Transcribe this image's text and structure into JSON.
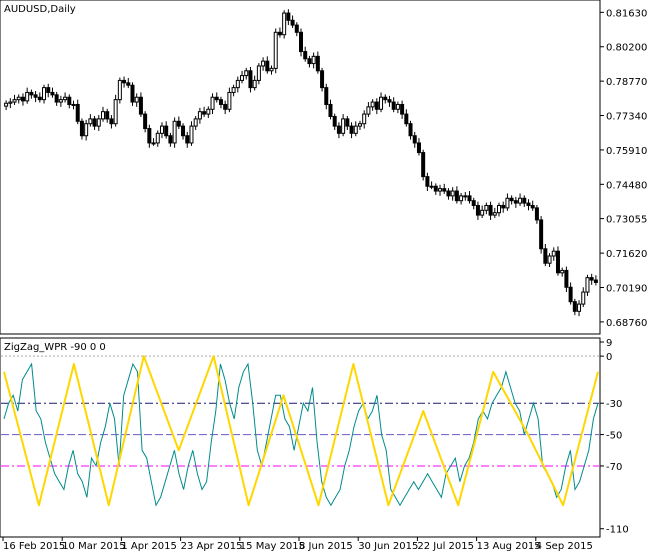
{
  "price_panel": {
    "title": "AUDUSD,Daily",
    "price_ticks": [
      "0.81630",
      "0.80200",
      "0.78770",
      "0.77340",
      "0.75910",
      "0.74480",
      "0.73055",
      "0.71620",
      "0.70190",
      "0.68760"
    ],
    "price_tick_values": [
      0.8163,
      0.802,
      0.7877,
      0.7734,
      0.7591,
      0.7448,
      0.73055,
      0.7162,
      0.7019,
      0.6876
    ]
  },
  "indicator_panel": {
    "title": "ZigZag_WPR -90 0 0",
    "ticks": [
      "9",
      "0",
      "-30",
      "-50",
      "-70",
      "-110"
    ],
    "tick_values": [
      9,
      0,
      -30,
      -50,
      -70,
      -110
    ]
  },
  "time_axis": {
    "labels": [
      "16 Feb 2015",
      "10 Mar 2015",
      "1 Apr 2015",
      "23 Apr 2015",
      "15 May 2015",
      "8 Jun 2015",
      "30 Jun 2015",
      "22 Jul 2015",
      "13 Aug 2015",
      "4 Sep 2015"
    ]
  },
  "colors": {
    "background": "#ffffff",
    "frame": "#000000",
    "candle": "#000000",
    "wpr_line": "#008b8b",
    "zigzag_line": "#ffd700",
    "level_minus30": "#191970",
    "level_minus50": "#6a5acd",
    "level_minus70": "#ff00ff",
    "level_0": "#a9a9a9"
  },
  "chart_data": [
    {
      "type": "candlestick",
      "title": "AUDUSD,Daily",
      "ylim": [
        0.6834,
        0.8206
      ],
      "closes": [
        0.7785,
        0.779,
        0.78,
        0.781,
        0.7795,
        0.783,
        0.782,
        0.781,
        0.78,
        0.785,
        0.783,
        0.782,
        0.779,
        0.78,
        0.781,
        0.778,
        0.778,
        0.771,
        0.765,
        0.77,
        0.772,
        0.769,
        0.772,
        0.775,
        0.772,
        0.77,
        0.78,
        0.788,
        0.787,
        0.786,
        0.779,
        0.781,
        0.774,
        0.768,
        0.762,
        0.762,
        0.766,
        0.769,
        0.765,
        0.762,
        0.771,
        0.769,
        0.765,
        0.762,
        0.769,
        0.772,
        0.775,
        0.774,
        0.776,
        0.781,
        0.78,
        0.778,
        0.776,
        0.783,
        0.785,
        0.788,
        0.79,
        0.792,
        0.785,
        0.788,
        0.794,
        0.796,
        0.792,
        0.793,
        0.808,
        0.807,
        0.816,
        0.813,
        0.811,
        0.808,
        0.8,
        0.797,
        0.795,
        0.798,
        0.792,
        0.785,
        0.778,
        0.773,
        0.769,
        0.766,
        0.772,
        0.769,
        0.766,
        0.769,
        0.77,
        0.774,
        0.777,
        0.779,
        0.776,
        0.781,
        0.78,
        0.779,
        0.776,
        0.778,
        0.774,
        0.77,
        0.765,
        0.762,
        0.758,
        0.748,
        0.744,
        0.744,
        0.742,
        0.743,
        0.742,
        0.74,
        0.742,
        0.738,
        0.74,
        0.74,
        0.738,
        0.736,
        0.732,
        0.734,
        0.736,
        0.732,
        0.733,
        0.736,
        0.735,
        0.739,
        0.738,
        0.737,
        0.739,
        0.737,
        0.736,
        0.735,
        0.73,
        0.718,
        0.712,
        0.715,
        0.717,
        0.708,
        0.709,
        0.702,
        0.696,
        0.692,
        0.695,
        0.7,
        0.706,
        0.705,
        0.704
      ]
    },
    {
      "type": "line",
      "title": "ZigZag_WPR -90 0 0",
      "series": [
        {
          "values": [
            -40,
            -30,
            -25,
            -35,
            -15,
            -10,
            -5,
            -35,
            -40,
            -55,
            -65,
            -75,
            -80,
            -85,
            -70,
            -60,
            -75,
            -80,
            -90,
            -65,
            -70,
            -55,
            -45,
            -30,
            -40,
            -70,
            -25,
            -15,
            -5,
            -10,
            -60,
            -65,
            -80,
            -95,
            -90,
            -80,
            -70,
            -60,
            -75,
            -85,
            -70,
            -60,
            -75,
            -85,
            -80,
            -55,
            -35,
            -5,
            -15,
            -30,
            -40,
            -20,
            -10,
            -5,
            -30,
            -60,
            -70,
            -55,
            -40,
            -25,
            -25,
            -40,
            -45,
            -60,
            -45,
            -30,
            -35,
            -20,
            -55,
            -80,
            -90,
            -95,
            -90,
            -85,
            -70,
            -60,
            -45,
            -35,
            -30,
            -40,
            -35,
            -25,
            -50,
            -60,
            -85,
            -90,
            -95,
            -90,
            -85,
            -80,
            -85,
            -80,
            -75,
            -80,
            -85,
            -90,
            -75,
            -70,
            -65,
            -80,
            -70,
            -65,
            -55,
            -40,
            -35,
            -40,
            -30,
            -25,
            -20,
            -10,
            -20,
            -30,
            -35,
            -50,
            -40,
            -30,
            -40,
            -70,
            -75,
            -80,
            -90,
            -85,
            -70,
            -60,
            -85,
            -80,
            -70,
            -60,
            -40,
            -30
          ]
        },
        {
          "values": [
            -10,
            -95,
            -5,
            -95,
            0,
            -60,
            0,
            -95,
            -25,
            -95,
            -5,
            -95,
            -35,
            -95,
            -10,
            -50,
            -95,
            -10
          ]
        }
      ],
      "ylim": [
        -114,
        9
      ],
      "levels": [
        0,
        -30,
        -50,
        -70
      ]
    }
  ]
}
